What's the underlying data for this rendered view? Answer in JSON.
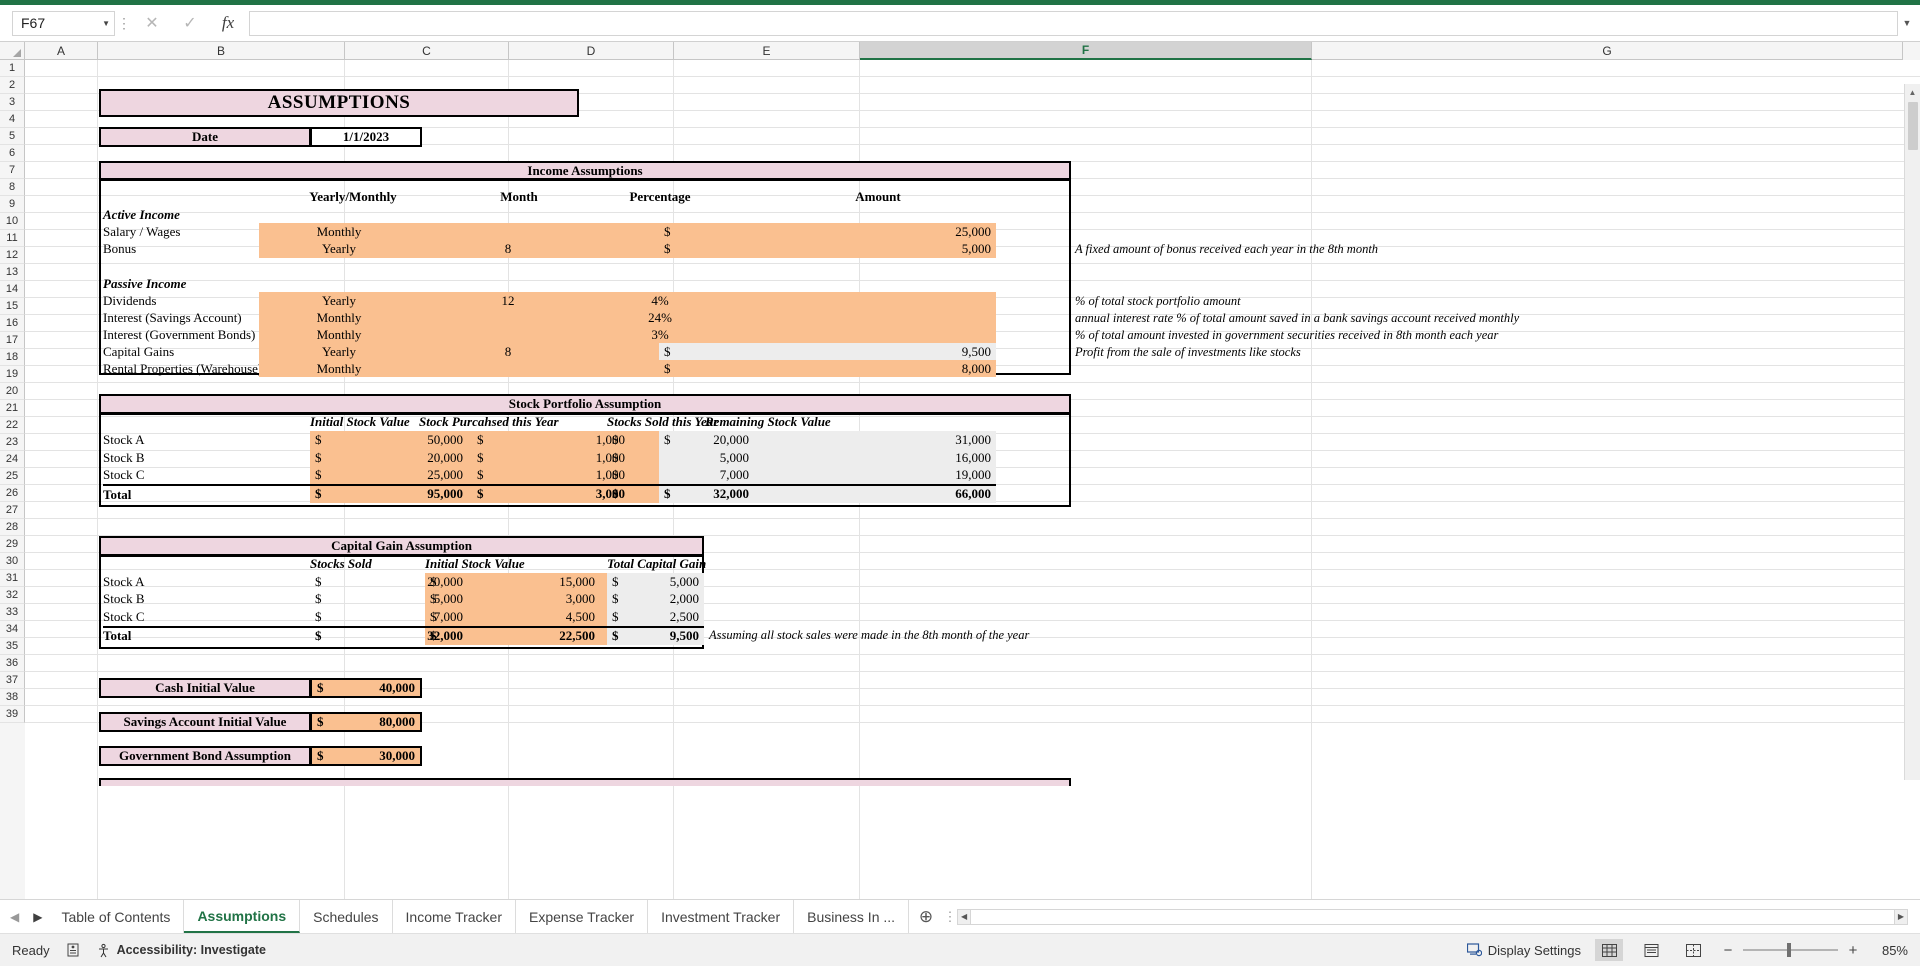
{
  "window": {
    "name_box_value": "F67",
    "formula_value": "",
    "icons": {
      "cancel": "close-icon",
      "confirm": "check-icon",
      "function": "fx-icon",
      "more": "vertical-dots-icon",
      "expand": "chevron-down-icon"
    }
  },
  "grid": {
    "columns": [
      "A",
      "B",
      "C",
      "D",
      "E",
      "F",
      "G"
    ],
    "selected_column": "F",
    "rows": [
      1,
      2,
      3,
      4,
      5,
      6,
      7,
      8,
      9,
      10,
      11,
      12,
      13,
      14,
      15,
      16,
      17,
      18,
      19,
      20,
      21,
      22,
      23,
      24,
      25,
      26,
      27,
      28,
      29,
      30,
      31,
      32,
      33,
      34,
      35,
      36,
      37,
      38,
      39
    ]
  },
  "sheet": {
    "title": "ASSUMPTIONS",
    "date_label": "Date",
    "date_value": "1/1/2023",
    "income": {
      "header": "Income Assumptions",
      "columns": [
        "Yearly/Monthly",
        "Month",
        "Percentage",
        "Amount"
      ],
      "active_label": "Active Income",
      "passive_label": "Passive Income",
      "active_rows": [
        {
          "name": "Salary / Wages",
          "freq": "Monthly",
          "month": "",
          "pct": "",
          "cur": "$",
          "amount": "25,000",
          "note": ""
        },
        {
          "name": "Bonus",
          "freq": "Yearly",
          "month": "8",
          "pct": "",
          "cur": "$",
          "amount": "5,000",
          "note": "A fixed amount of bonus received each year in the 8th month"
        }
      ],
      "passive_rows": [
        {
          "name": "Dividends",
          "freq": "Yearly",
          "month": "12",
          "pct": "4%",
          "cur": "",
          "amount": "",
          "note": "% of total stock portfolio amount"
        },
        {
          "name": "Interest (Savings Account)",
          "freq": "Monthly",
          "month": "",
          "pct": "24%",
          "cur": "",
          "amount": "",
          "note": "annual interest rate % of total amount saved in a bank savings account received monthly"
        },
        {
          "name": "Interest (Government Bonds)",
          "freq": "Monthly",
          "month": "",
          "pct": "3%",
          "cur": "",
          "amount": "",
          "note": "% of total amount invested in government securities received in 8th month each year"
        },
        {
          "name": "Capital Gains",
          "freq": "Yearly",
          "month": "8",
          "pct": "",
          "cur": "$",
          "amount": "9,500",
          "note": "Profit from the sale of investments like stocks"
        },
        {
          "name": "Rental Properties (Warehouse)",
          "freq": "Monthly",
          "month": "",
          "pct": "",
          "cur": "$",
          "amount": "8,000",
          "note": ""
        }
      ]
    },
    "stock_portfolio": {
      "header": "Stock Portfolio Assumption",
      "columns": [
        "Initial Stock Value",
        "Stock Purcahsed this Year",
        "Stocks Sold this Year",
        "Remaining Stock Value"
      ],
      "rows": [
        {
          "name": "Stock A",
          "initial": "50,000",
          "purchased": "1,000",
          "sold": "20,000",
          "remaining": "31,000"
        },
        {
          "name": "Stock B",
          "initial": "20,000",
          "purchased": "1,000",
          "sold": "5,000",
          "remaining": "16,000"
        },
        {
          "name": "Stock C",
          "initial": "25,000",
          "purchased": "1,000",
          "sold": "7,000",
          "remaining": "19,000"
        }
      ],
      "total": {
        "name": "Total",
        "initial": "95,000",
        "purchased": "3,000",
        "sold": "32,000",
        "remaining": "66,000"
      },
      "currency": "$"
    },
    "capital_gain": {
      "header": "Capital Gain Assumption",
      "columns": [
        "Stocks Sold",
        "Initial Stock Value",
        "Total Capital Gain"
      ],
      "rows": [
        {
          "name": "Stock A",
          "sold": "20,000",
          "initial": "15,000",
          "gain": "5,000"
        },
        {
          "name": "Stock B",
          "sold": "5,000",
          "initial": "3,000",
          "gain": "2,000"
        },
        {
          "name": "Stock C",
          "sold": "7,000",
          "initial": "4,500",
          "gain": "2,500"
        }
      ],
      "total": {
        "name": "Total",
        "sold": "32,000",
        "initial": "22,500",
        "gain": "9,500"
      },
      "note": "Assuming all stock sales were made in the 8th month of the year",
      "currency": "$"
    },
    "single_values": [
      {
        "label": "Cash Initial Value",
        "currency": "$",
        "value": "40,000"
      },
      {
        "label": "Savings Account Initial Value",
        "currency": "$",
        "value": "80,000"
      },
      {
        "label": "Government Bond Assumption",
        "currency": "$",
        "value": "30,000"
      }
    ]
  },
  "tabs": {
    "items": [
      {
        "label": "Table of Contents",
        "active": false
      },
      {
        "label": "Assumptions",
        "active": true
      },
      {
        "label": "Schedules",
        "active": false
      },
      {
        "label": "Income Tracker",
        "active": false
      },
      {
        "label": "Expense Tracker",
        "active": false
      },
      {
        "label": "Investment Tracker",
        "active": false
      },
      {
        "label": "Business In ...",
        "active": false
      }
    ],
    "add_label": "+",
    "more_label": "⋮"
  },
  "status": {
    "ready": "Ready",
    "accessibility": "Accessibility: Investigate",
    "display_settings": "Display Settings",
    "zoom": "85%",
    "zoom_minus": "−",
    "zoom_plus": "+"
  },
  "colors": {
    "accent_green": "#217346",
    "pink_header": "#eed6e0",
    "orange_fill": "#fac090",
    "gray_fill": "#ededed"
  }
}
